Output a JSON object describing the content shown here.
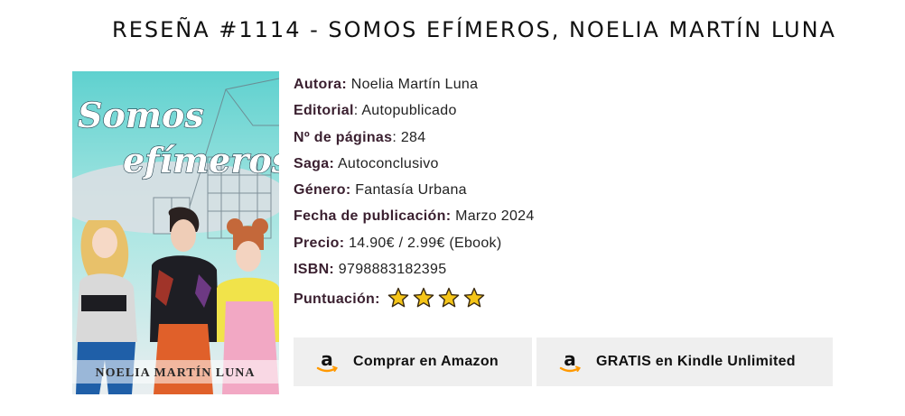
{
  "header": {
    "title": "RESEÑA #1114 - SOMOS EFÍMEROS, NOELIA MARTÍN LUNA"
  },
  "cover": {
    "title_line1": "Somos",
    "title_line2": "efímeros",
    "author": "NOELIA MARTÍN LUNA"
  },
  "details": [
    {
      "label": "Autora:",
      "value": " Noelia Martín Luna"
    },
    {
      "label": "Editorial",
      "value": ": Autopublicado"
    },
    {
      "label": "Nº de páginas",
      "value": ": 284"
    },
    {
      "label": "Saga:",
      "value": " Autoconclusivo"
    },
    {
      "label": "Género:",
      "value": " Fantasía Urbana"
    },
    {
      "label": "Fecha de publicación:",
      "value": " Marzo 2024"
    },
    {
      "label": "Precio:",
      "value": " 14.90€ / 2.99€ (Ebook)"
    },
    {
      "label": "ISBN:",
      "value": " 9798883182395"
    }
  ],
  "rating": {
    "label": "Puntuación:",
    "stars": 4,
    "star_color": "#f5c518",
    "star_outline": "#3a2a10"
  },
  "buttons": {
    "amazon_label": "Comprar en Amazon",
    "kindle_label": "GRATIS en Kindle Unlimited",
    "icon": "amazon-logo-icon",
    "accent": "#ff9900"
  }
}
